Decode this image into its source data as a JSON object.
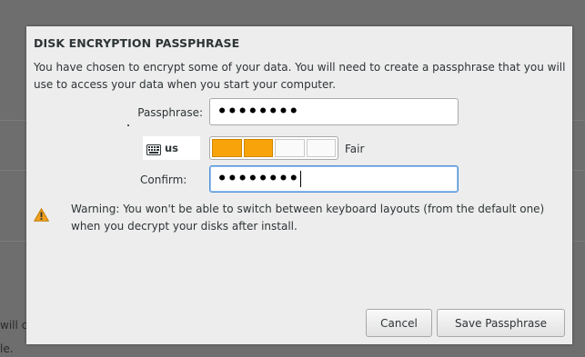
{
  "background": {
    "fragment_1": "will co",
    "fragment_2": "le."
  },
  "dialog": {
    "title": "DISK ENCRYPTION PASSPHRASE",
    "description": "You have chosen to encrypt some of your data. You will need to create a passphrase that you will use to access your data when you start your computer.",
    "passphrase_label": "Passphrase:",
    "passphrase_value": "••••••••",
    "keyboard_layout": "us",
    "keyboard_icon": "keyboard-icon",
    "strength": {
      "level": 2,
      "max": 4,
      "label": "Fair",
      "color": "#f8a30a"
    },
    "confirm_label": "Confirm:",
    "confirm_value": "••••••••",
    "warning_icon": "warning-triangle-icon",
    "warning_text": "Warning: You won't be able to switch between keyboard layouts (from the default one) when you decrypt your disks after install.",
    "cancel_label": "Cancel",
    "save_label": "Save Passphrase"
  }
}
